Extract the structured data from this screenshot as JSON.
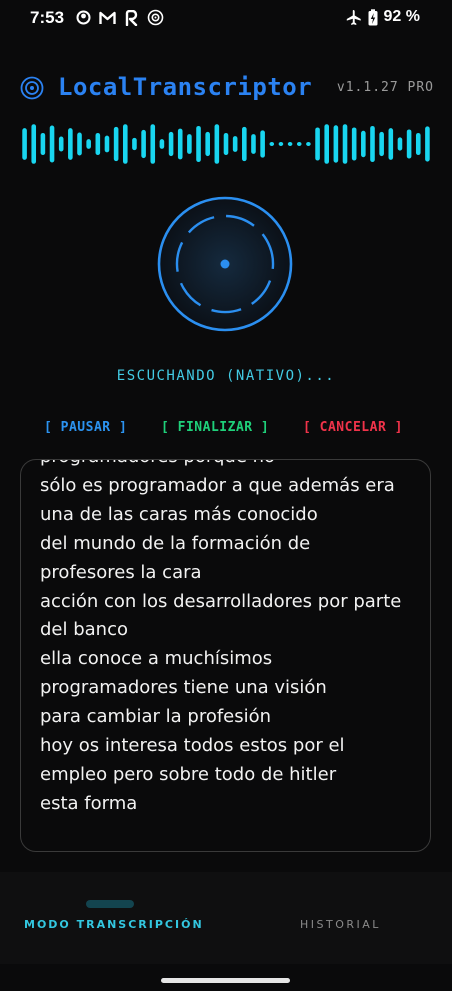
{
  "status_bar": {
    "time": "7:53",
    "battery_percent": "92 %",
    "left_icons": [
      "circle-app-icon",
      "gmail-icon",
      "r-app-icon",
      "target-app-icon"
    ],
    "right_icons": [
      "airplane-icon",
      "battery-charging-icon"
    ]
  },
  "header": {
    "title": "LocalTranscriptor",
    "version": "v1.1.27 PRO",
    "logo_icon": "concentric-circle-icon"
  },
  "waveform": {
    "color": "#19d6f0",
    "levels": [
      0.72,
      0.9,
      0.5,
      0.84,
      0.34,
      0.72,
      0.52,
      0.22,
      0.5,
      0.38,
      0.78,
      0.9,
      0.28,
      0.64,
      0.9,
      0.22,
      0.55,
      0.7,
      0.45,
      0.82,
      0.55,
      0.9,
      0.5,
      0.36,
      0.78,
      0.45,
      0.62,
      0.08,
      0.08,
      0.08,
      0.08,
      0.08,
      0.75,
      0.9,
      0.85,
      0.9,
      0.75,
      0.6,
      0.82,
      0.55,
      0.72,
      0.3,
      0.66,
      0.5,
      0.8
    ]
  },
  "mic": {
    "status": "ESCUCHANDO (NATIVO)..."
  },
  "actions": {
    "pause": "[ PAUSAR ]",
    "finish": "[ FINALIZAR ]",
    "cancel": "[ CANCELAR ]"
  },
  "transcript": {
    "lines": [
      "programadores porque no",
      "sólo es programador a que además era",
      "una de las caras más conocido",
      "del mundo de la formación de",
      "profesores la cara",
      "acción con los desarrolladores por parte",
      "del banco",
      "ella conoce a muchísimos",
      "programadores tiene una visión",
      "para cambiar la profesión",
      "hoy os interesa todos estos por el",
      "empleo pero sobre todo de hitler",
      "esta forma"
    ]
  },
  "nav": {
    "transcription_tab": "MODO TRANSCRIPCIÓN",
    "history_tab": "HISTORIAL",
    "active": "transcription"
  },
  "colors": {
    "accent_blue": "#2b82f2",
    "cyan": "#19d6f0",
    "green": "#1fd07a",
    "red": "#f0334a",
    "background": "#0a0a0b"
  }
}
